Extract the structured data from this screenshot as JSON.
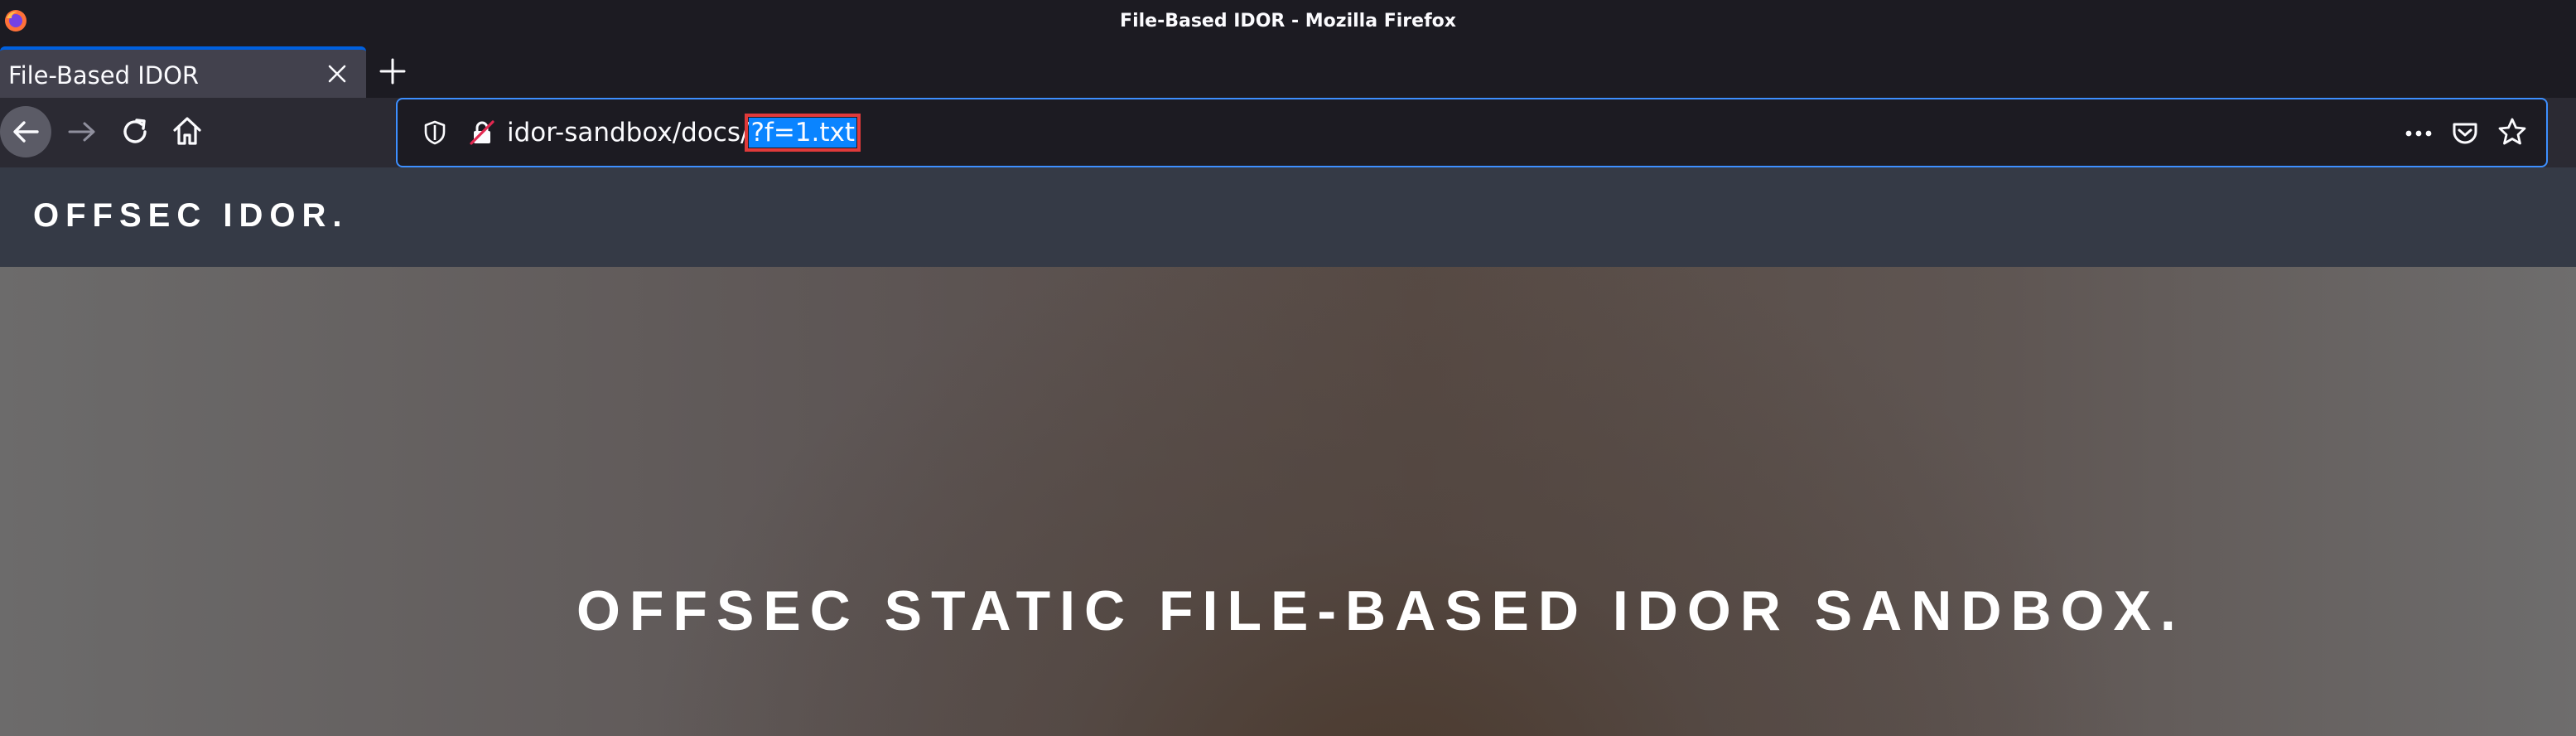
{
  "window": {
    "title": "File-Based IDOR - Mozilla Firefox",
    "app_icon": "firefox-icon"
  },
  "tabs": [
    {
      "label": "File-Based IDOR",
      "active": true
    }
  ],
  "toolbar": {
    "back_icon": "back-arrow-icon",
    "forward_icon": "forward-arrow-icon",
    "reload_icon": "reload-icon",
    "home_icon": "home-icon"
  },
  "urlbar": {
    "url_base": "idor-sandbox/docs/",
    "url_query": "?f=1.txt",
    "query_highlight_color": "#0a84ff",
    "annotation_color": "#e03a3a"
  },
  "page": {
    "logo": "OFFSEC IDOR.",
    "hero_title": "OFFSEC STATIC FILE-BASED IDOR SANDBOX."
  },
  "colors": {
    "accent": "#3d8fff",
    "chrome_bg": "#1c1b22",
    "toolbar_bg": "#2b2a33",
    "site_header_bg": "#353a46"
  }
}
